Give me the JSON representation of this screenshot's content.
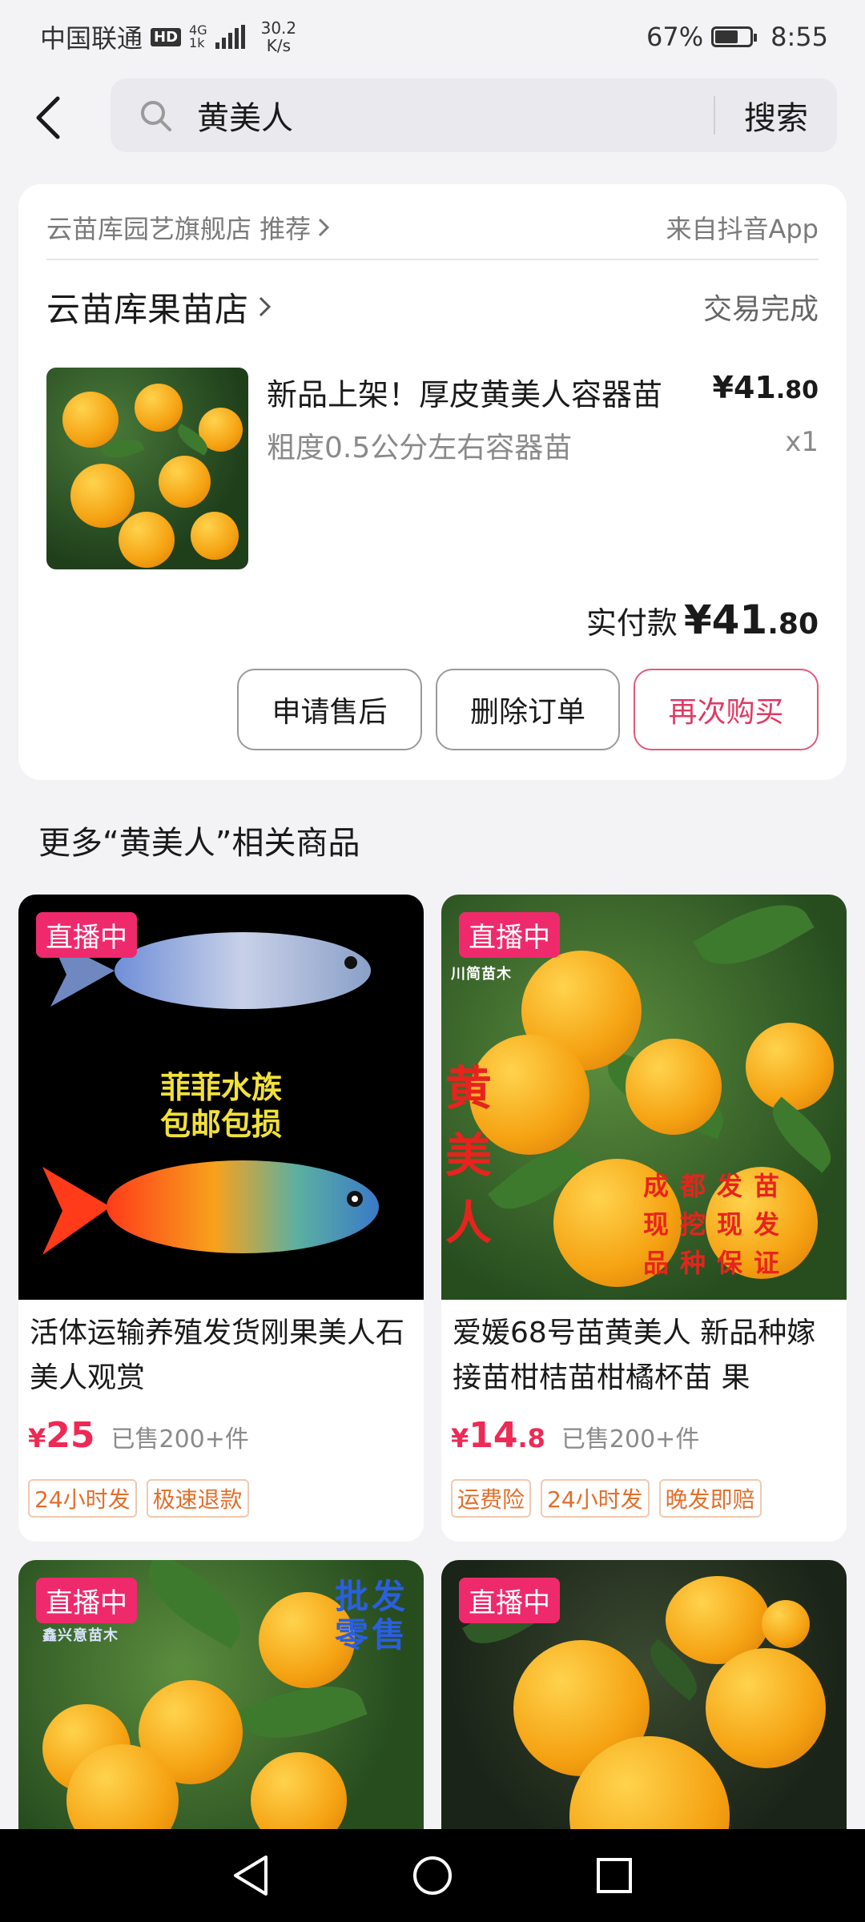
{
  "status_bar": {
    "carrier": "中国联通",
    "hd": "HD",
    "net": "4G",
    "net_sub": "1k",
    "speed_value": "30.2",
    "speed_unit": "K/s",
    "battery": "67%",
    "time": "8:55"
  },
  "search": {
    "query": "黄美人",
    "button": "搜索"
  },
  "order": {
    "recommend_text": "云苗库园艺旗舰店 推荐",
    "source": "来自抖音App",
    "shop_name": "云苗库果苗店",
    "status": "交易完成",
    "product_title": "新品上架！厚皮黄美人容器苗",
    "product_spec": "粗度0.5公分左右容器苗",
    "price_int": "¥41",
    "price_dec": ".80",
    "quantity": "x1",
    "paid_label": "实付款",
    "paid_int": "¥41",
    "paid_dec": ".80",
    "buttons": {
      "after_sale": "申请售后",
      "delete": "删除订单",
      "rebuy": "再次购买"
    }
  },
  "related": {
    "title": "更多“黄美人”相关商品",
    "items": [
      {
        "badge": "直播中",
        "image_text": [
          "菲菲水族",
          "包邮包损"
        ],
        "title": "活体运输养殖发货刚果美人石美人观赏",
        "price_currency": "¥",
        "price_int": "25",
        "price_dec": "",
        "sold": "已售200+件",
        "tags": [
          "24小时发",
          "极速退款"
        ]
      },
      {
        "badge": "直播中",
        "image_text": {
          "vertical": [
            "黄",
            "美",
            "人"
          ],
          "lines": [
            "成都发苗",
            "现挖现发",
            "品种保证"
          ],
          "logo": "川简苗木"
        },
        "title": "爱媛68号苗黄美人 新品种嫁接苗柑桔苗柑橘杯苗 果",
        "price_currency": "¥",
        "price_int": "14",
        "price_dec": ".8",
        "sold": "已售200+件",
        "tags": [
          "运费险",
          "24小时发",
          "晚发即赔"
        ]
      },
      {
        "badge": "直播中",
        "image_text": {
          "lines": [
            "批发",
            "零售"
          ],
          "logo": "鑫兴意苗木"
        }
      },
      {
        "badge": "直播中"
      }
    ]
  },
  "colors": {
    "accent_pink": "#ee2a6c",
    "price_red": "#ee2a54",
    "tag_orange": "#e36f2b",
    "background": "#f3f3f6"
  },
  "icons": [
    "back-arrow-icon",
    "search-icon",
    "chevron-right-icon",
    "nav-back-icon",
    "nav-home-icon",
    "nav-recents-icon"
  ]
}
